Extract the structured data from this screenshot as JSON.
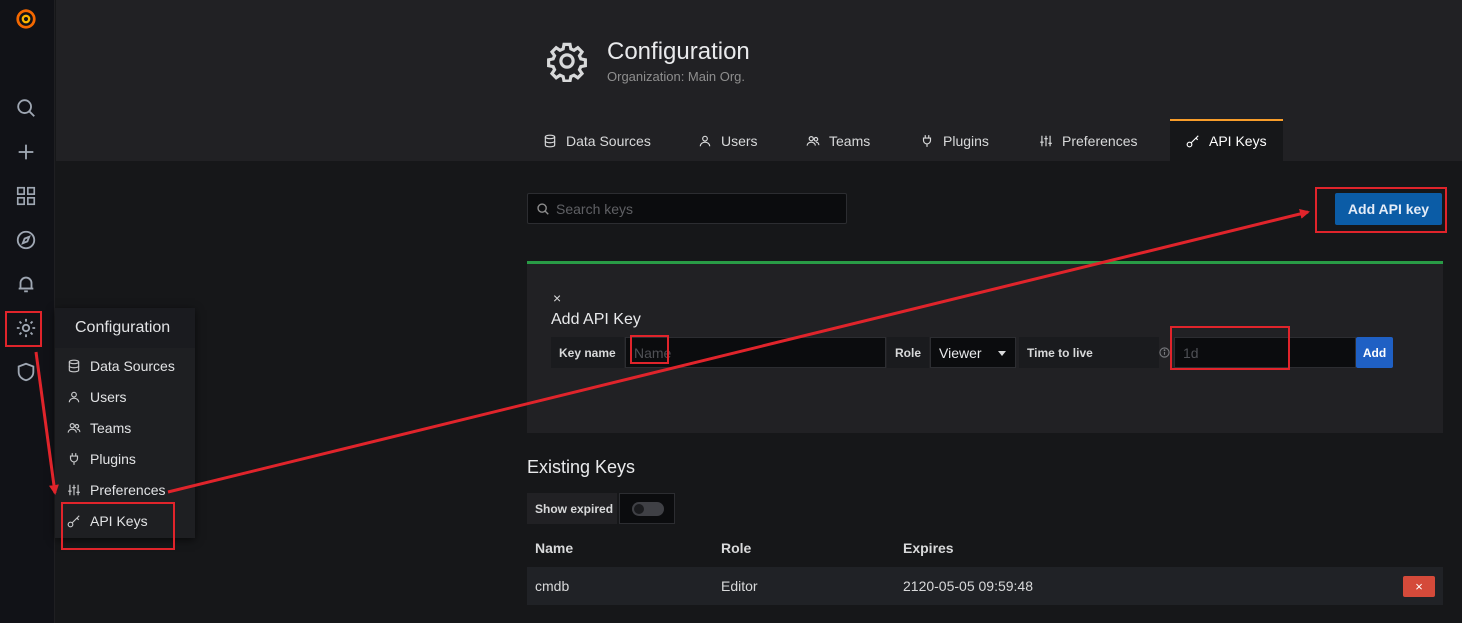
{
  "header": {
    "title": "Configuration",
    "subtitle": "Organization: Main Org."
  },
  "tabs": [
    {
      "label": "Data Sources",
      "icon": "database-icon"
    },
    {
      "label": "Users",
      "icon": "user-icon"
    },
    {
      "label": "Teams",
      "icon": "users-icon"
    },
    {
      "label": "Plugins",
      "icon": "plug-icon"
    },
    {
      "label": "Preferences",
      "icon": "sliders-icon"
    },
    {
      "label": "API Keys",
      "icon": "key-icon",
      "active": true
    }
  ],
  "flyout": {
    "title": "Configuration",
    "items": [
      {
        "label": "Data Sources",
        "icon": "database-icon"
      },
      {
        "label": "Users",
        "icon": "user-icon"
      },
      {
        "label": "Teams",
        "icon": "users-icon"
      },
      {
        "label": "Plugins",
        "icon": "plug-icon"
      },
      {
        "label": "Preferences",
        "icon": "sliders-icon"
      },
      {
        "label": "API Keys",
        "icon": "key-icon"
      }
    ]
  },
  "sidebar": {
    "icons": [
      "grafana-logo",
      "search-icon",
      "plus-icon",
      "dashboards-icon",
      "explore-icon",
      "alerting-icon",
      "gear-icon",
      "shield-icon"
    ]
  },
  "search": {
    "placeholder": "Search keys"
  },
  "add_button_label": "Add API key",
  "add_panel": {
    "close": "×",
    "title": "Add API Key",
    "key_name_label": "Key name",
    "key_name_placeholder": "Name",
    "role_label": "Role",
    "role_value": "Viewer",
    "ttl_label": "Time to live",
    "ttl_placeholder": "1d",
    "add_label": "Add"
  },
  "existing": {
    "title": "Existing Keys",
    "show_expired_label": "Show expired",
    "show_expired_on": false,
    "columns": [
      "Name",
      "Role",
      "Expires"
    ],
    "rows": [
      {
        "name": "cmdb",
        "role": "Editor",
        "expires": "2120-05-05 09:59:48"
      }
    ],
    "delete_label": "×"
  },
  "colors": {
    "primary": "#0b5ca6",
    "success_border": "#299c46",
    "danger": "#d44a3a",
    "annotation": "#e0242b",
    "active_tab": "#f89d2a"
  }
}
